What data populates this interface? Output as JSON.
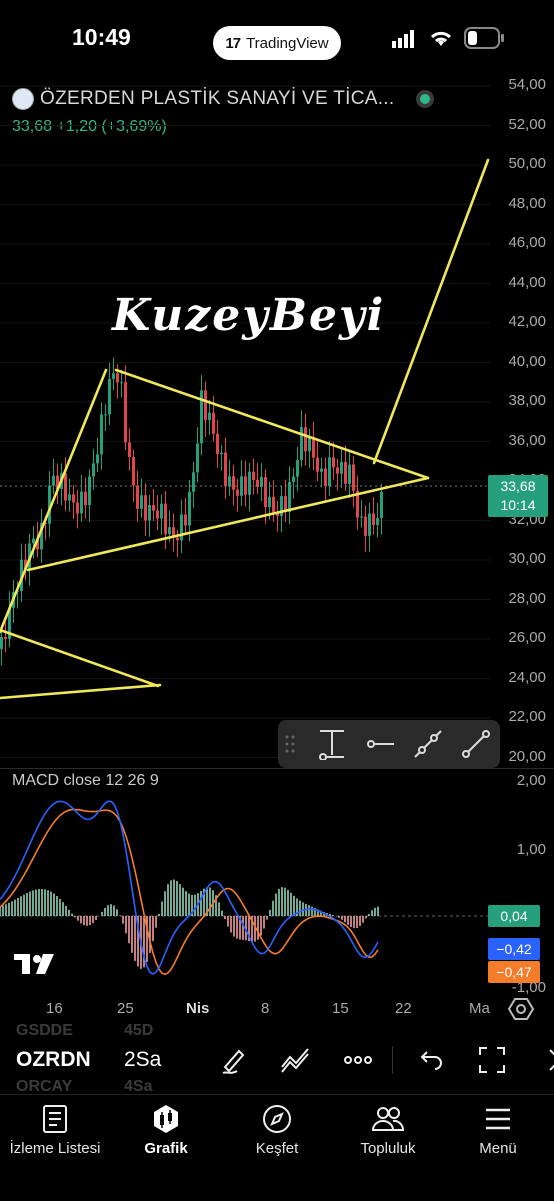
{
  "status_bar": {
    "time": "10:49",
    "pill_label": "TradingView",
    "pill_logo": "17"
  },
  "symbol": {
    "name": "ÖZERDEN PLASTİK SANAYİ VE TİCA...",
    "price_change": "33,68  +1,20 (+3,69%)"
  },
  "watermark": "KuzeyBeyi",
  "price_axis": {
    "ticks": [
      "54,00",
      "52,00",
      "50,00",
      "48,00",
      "46,00",
      "44,00",
      "42,00",
      "40,00",
      "38,00",
      "36,00",
      "34,00",
      "32,00",
      "30,00",
      "28,00",
      "26,00",
      "24,00",
      "22,00",
      "20,00"
    ]
  },
  "last_price": {
    "price": "33,68",
    "countdown": "10:14"
  },
  "macd": {
    "label": "MACD close  12  26  9",
    "axis_ticks": [
      "2,00",
      "1,00",
      "-1,00"
    ],
    "histogram_value": "0,04",
    "macd_value": "−0,42",
    "signal_value": "−0,47"
  },
  "time_axis": {
    "ticks": [
      "16",
      "25",
      "Nis",
      "8",
      "15",
      "22",
      "Ma"
    ]
  },
  "bottom_bar": {
    "ticker": "OZRDN",
    "interval": "2Sa",
    "ghost_rows": [
      {
        "ticker": "GSDDE",
        "interval": "45D"
      },
      {
        "ticker": "ORCAY",
        "interval": "4Sa"
      }
    ]
  },
  "tabs": [
    {
      "label": "İzleme Listesi",
      "icon": "watchlist-icon"
    },
    {
      "label": "Grafik",
      "icon": "chart-icon"
    },
    {
      "label": "Keşfet",
      "icon": "compass-icon"
    },
    {
      "label": "Topluluk",
      "icon": "community-icon"
    },
    {
      "label": "Menü",
      "icon": "menu-icon"
    }
  ],
  "colors": {
    "up": "#26a07c",
    "down": "#e0464a",
    "trendline": "#f0e85a",
    "macd_line": "#2962ff",
    "signal_line": "#f57c2a"
  }
}
